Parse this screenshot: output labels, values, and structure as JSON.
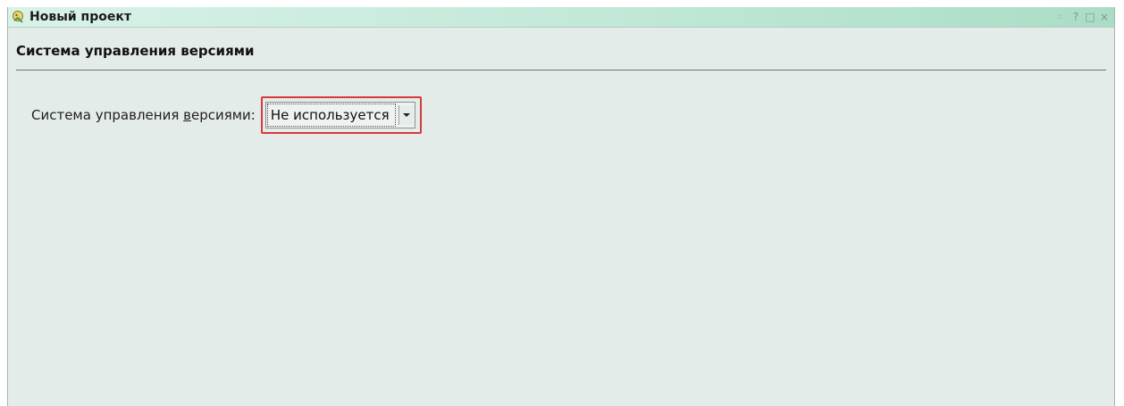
{
  "window": {
    "title": "Новый проект",
    "buttons": {
      "help": "?",
      "maximize": "□",
      "close": "×"
    }
  },
  "page": {
    "section_title": "Система управления версиями"
  },
  "vcs_field": {
    "label_before": "Система управления ",
    "label_mnemonic": "в",
    "label_after": "ерсиями:",
    "selected_value": "Не используется"
  },
  "colors": {
    "highlight_border": "#d63a3a",
    "panel_background": "#e4ece9",
    "titlebar_accent": "#bfe7d6"
  }
}
